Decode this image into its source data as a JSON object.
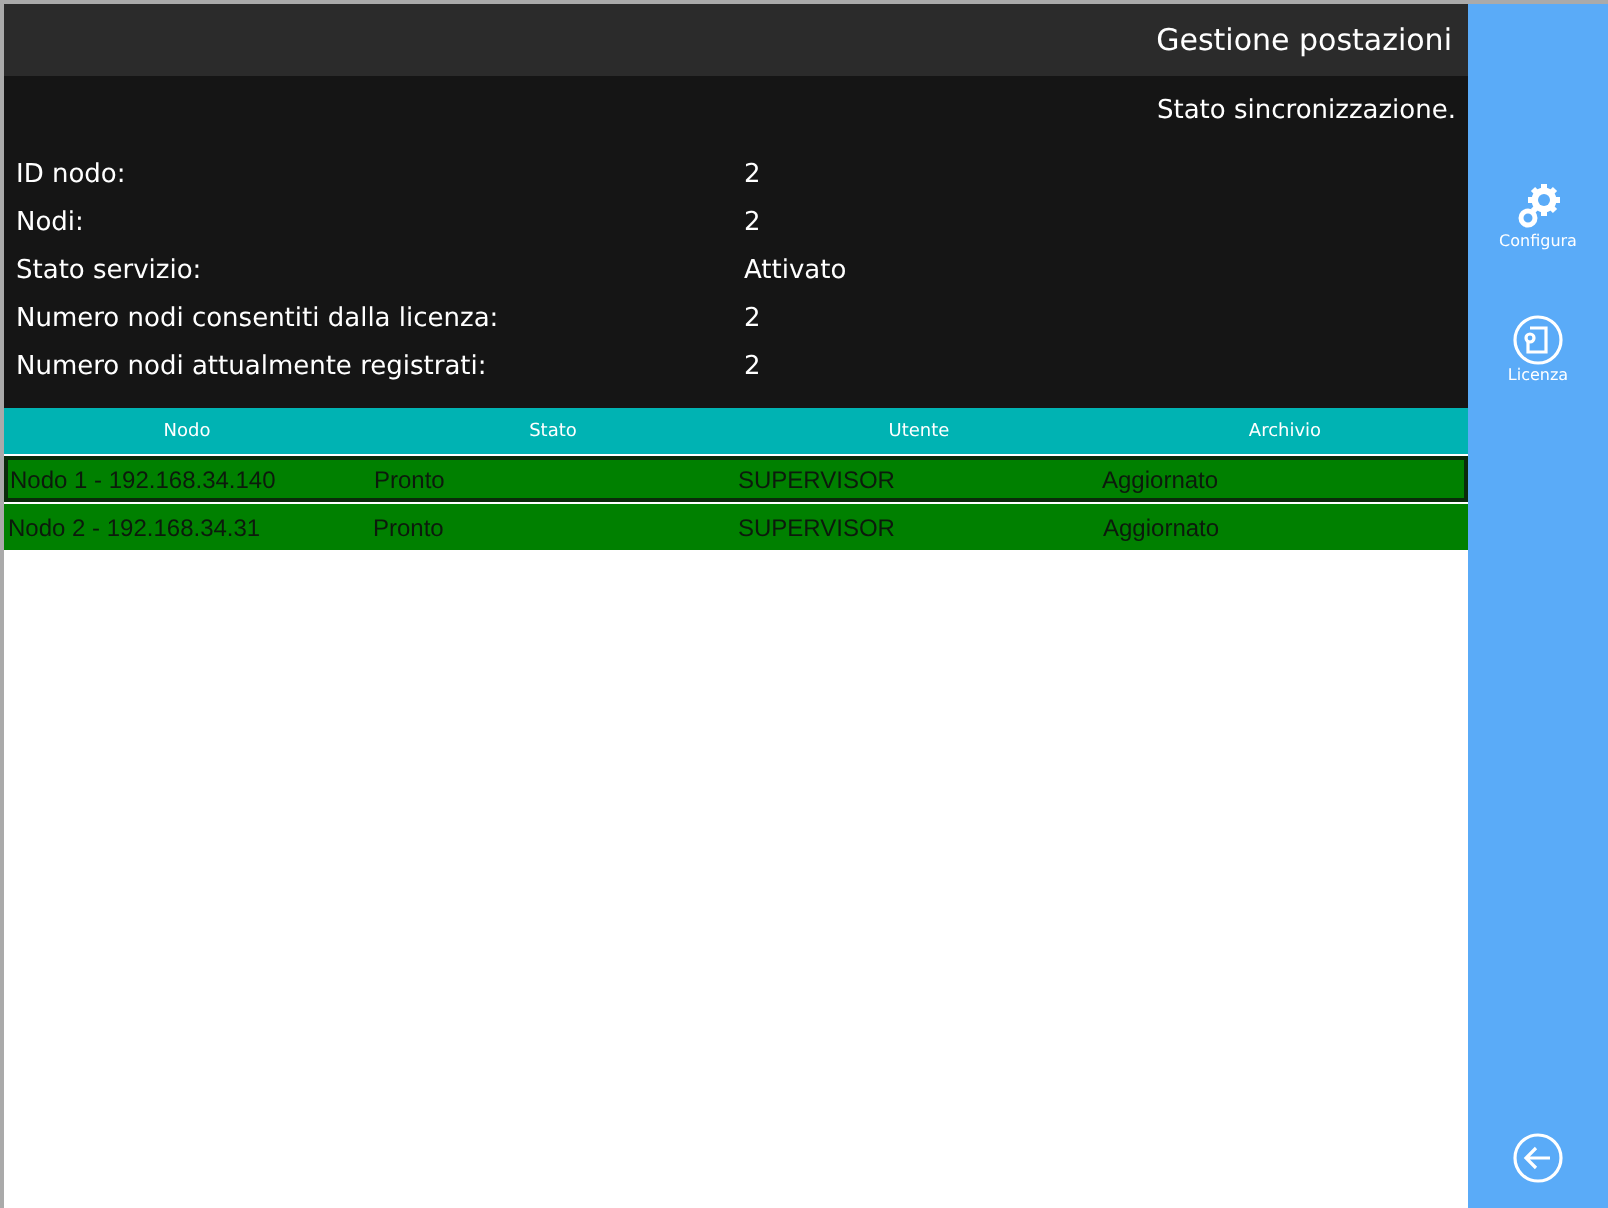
{
  "window": {
    "title": "Gestione postazioni"
  },
  "sync_title": "Stato sincronizzazione.",
  "info": [
    {
      "label": "ID nodo:",
      "value": "2"
    },
    {
      "label": "Nodi:",
      "value": "2"
    },
    {
      "label": "Stato servizio:",
      "value": "Attivato"
    },
    {
      "label": "Numero nodi consentiti dalla licenza:",
      "value": "2"
    },
    {
      "label": "Numero nodi attualmente registrati:",
      "value": "2"
    }
  ],
  "table": {
    "columns": [
      "Nodo",
      "Stato",
      "Utente",
      "Archivio"
    ],
    "rows": [
      {
        "cells": [
          "Nodo 1 - 192.168.34.140",
          "Pronto",
          "SUPERVISOR",
          "Aggiornato"
        ],
        "selected": true
      },
      {
        "cells": [
          "Nodo 2 - 192.168.34.31",
          "Pronto",
          "SUPERVISOR",
          "Aggiornato"
        ],
        "selected": false
      }
    ]
  },
  "sidebar": {
    "items": [
      {
        "kind": "gear",
        "label": "Configura"
      },
      {
        "kind": "license",
        "label": "Licenza"
      }
    ]
  }
}
